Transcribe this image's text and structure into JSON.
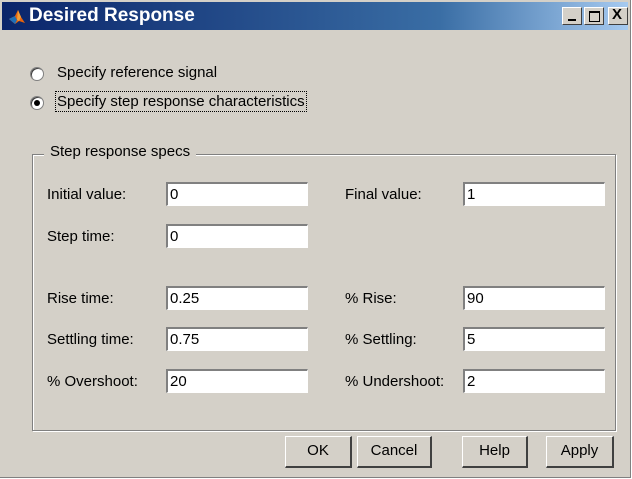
{
  "window": {
    "title": "Desired Response",
    "title_color": "#0a246a",
    "icon": "matlab-membrane-icon",
    "controls": [
      "minimize-icon",
      "maximize-icon",
      "close-icon"
    ],
    "close_glyph": "X"
  },
  "mode": {
    "options": [
      {
        "label": "Specify reference signal",
        "checked": false
      },
      {
        "label": "Specify step response characteristics",
        "checked": true
      }
    ]
  },
  "specs": {
    "group_title": "Step response specs",
    "initial_value": {
      "label": "Initial value:",
      "value": "0"
    },
    "final_value": {
      "label": "Final value:",
      "value": "1"
    },
    "step_time": {
      "label": "Step time:",
      "value": "0"
    },
    "rise_time": {
      "label": "Rise time:",
      "value": "0.25"
    },
    "pct_rise": {
      "label": "% Rise:",
      "value": "90"
    },
    "settling_time": {
      "label": "Settling time:",
      "value": "0.75"
    },
    "pct_settling": {
      "label": "% Settling:",
      "value": "5"
    },
    "pct_overshoot": {
      "label": "% Overshoot:",
      "value": "20"
    },
    "pct_undershoot": {
      "label": "% Undershoot:",
      "value": "2"
    }
  },
  "buttons": {
    "ok": "OK",
    "cancel": "Cancel",
    "help": "Help",
    "apply": "Apply"
  }
}
